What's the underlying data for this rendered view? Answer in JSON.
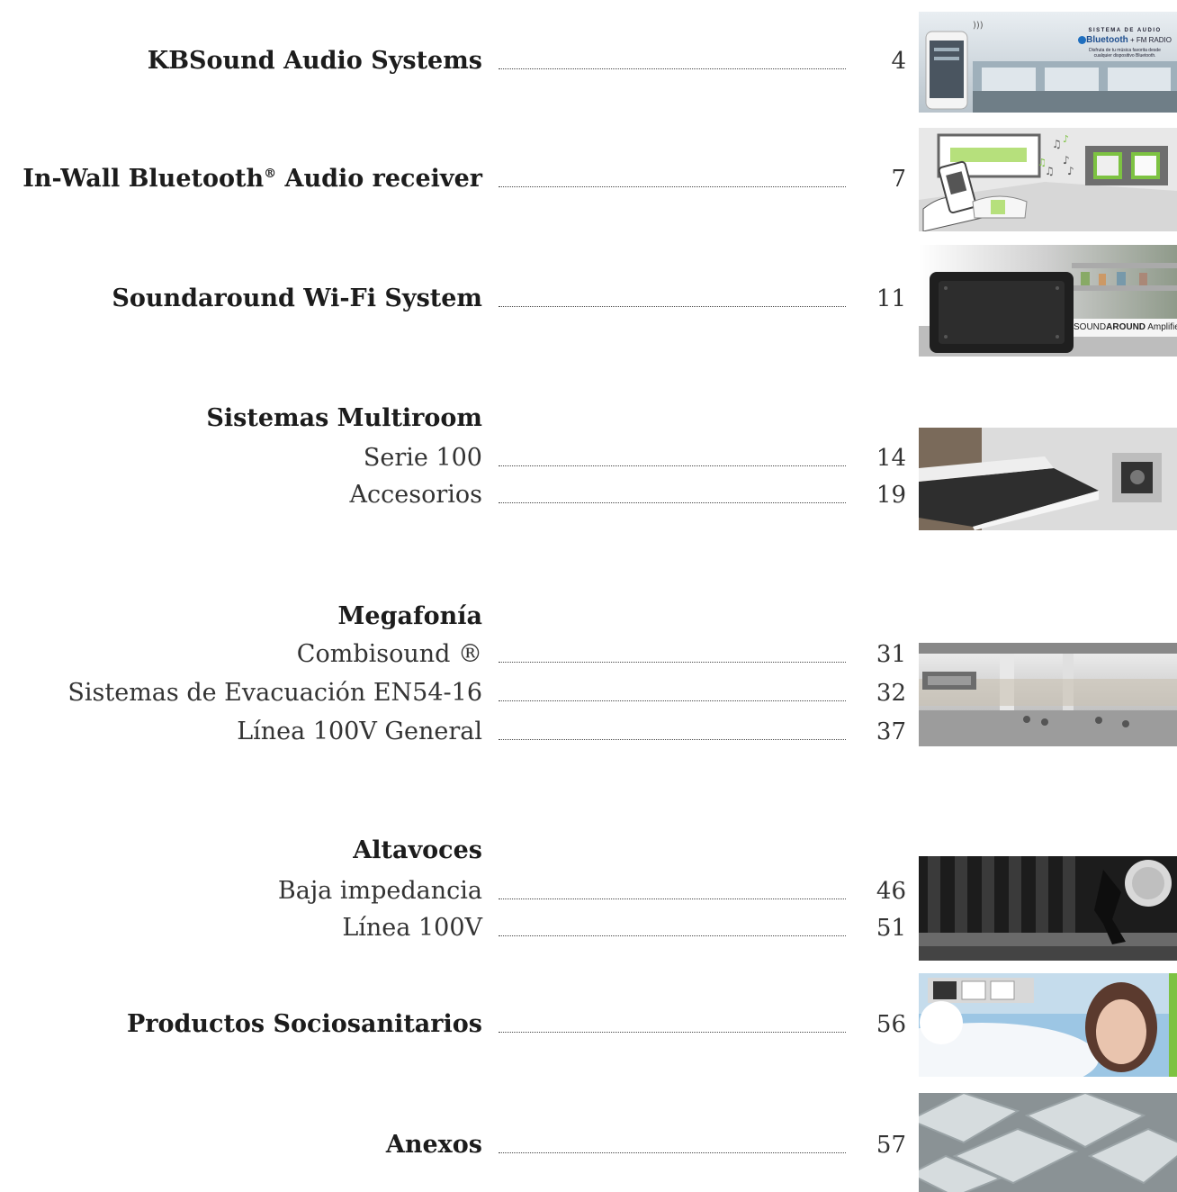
{
  "entries": {
    "kbsound": {
      "title": "KBSound Audio Systems",
      "page": "4"
    },
    "inwall": {
      "title": "In-Wall Bluetooth",
      "reg": "®",
      "title_rest": " Audio receiver",
      "page": "7"
    },
    "soundaround": {
      "title": "Soundaround Wi-Fi System",
      "page": "11"
    },
    "multiroom": {
      "heading": "Sistemas Multiroom",
      "items": [
        {
          "title": "Serie 100",
          "page": "14"
        },
        {
          "title": "Accesorios",
          "page": "19"
        }
      ]
    },
    "megafonia": {
      "heading": "Megafonía",
      "items": [
        {
          "title": "Combisound ®",
          "page": "31"
        },
        {
          "title": "Sistemas de Evacuación EN54-16",
          "page": "32"
        },
        {
          "title": "Línea 100V General",
          "page": "37"
        }
      ]
    },
    "altavoces": {
      "heading": "Altavoces",
      "items": [
        {
          "title": "Baja impedancia",
          "page": "46"
        },
        {
          "title": "Línea 100V",
          "page": "51"
        }
      ]
    },
    "sociosanitarios": {
      "title": "Productos Sociosanitarios",
      "page": "56"
    },
    "anexos": {
      "title": "Anexos",
      "page": "57"
    }
  },
  "thumbnails": {
    "kbsound": {
      "line1": "SISTEMA DE AUDIO",
      "line2": "Bluetooth",
      "line2b": " + FM RADIO",
      "line3": "Disfruta de tu música favorita desde",
      "line4": "cualquier dispositivo Bluetooth."
    },
    "soundaround": {
      "brand_a": "SOUND",
      "brand_b": "AROUND",
      "brand_c": " Amplifier"
    }
  },
  "colors": {
    "accent_green": "#7dc242",
    "text": "#1c1c1c"
  }
}
